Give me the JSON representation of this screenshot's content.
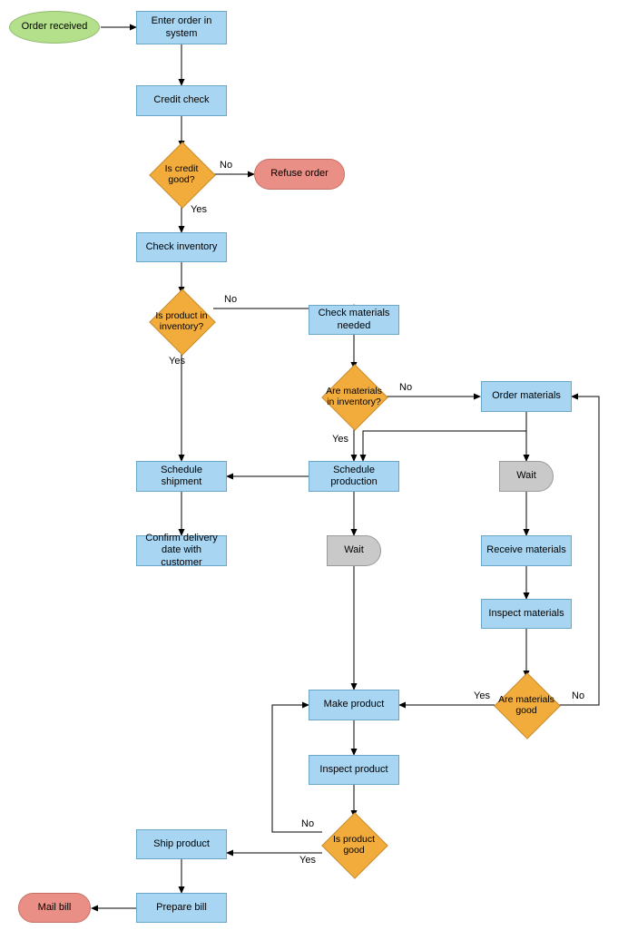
{
  "nodes": {
    "start": {
      "label": "Order received"
    },
    "enter_order": {
      "label": "Enter order in system"
    },
    "credit_check": {
      "label": "Credit check"
    },
    "is_credit_good": {
      "label": "Is credit good?"
    },
    "refuse_order": {
      "label": "Refuse order"
    },
    "check_inventory": {
      "label": "Check inventory"
    },
    "is_in_inventory": {
      "label": "Is product in inventory?"
    },
    "check_materials": {
      "label": "Check materials needed"
    },
    "are_mat_in_inv": {
      "label": "Are materials in inventory?"
    },
    "schedule_ship": {
      "label": "Schedule shipment"
    },
    "order_materials": {
      "label": "Order materials"
    },
    "schedule_prod": {
      "label": "Schedule production"
    },
    "confirm_delivery": {
      "label": "Confirm delivery date with customer"
    },
    "wait1": {
      "label": "Wait"
    },
    "wait2": {
      "label": "Wait"
    },
    "receive_mat": {
      "label": "Receive materials"
    },
    "inspect_mat": {
      "label": "Inspect materials"
    },
    "make_product": {
      "label": "Make product"
    },
    "are_mat_good": {
      "label": "Are materials good"
    },
    "inspect_product": {
      "label": "Inspect product"
    },
    "is_product_good": {
      "label": "Is product good"
    },
    "ship_product": {
      "label": "Ship product"
    },
    "prepare_bill": {
      "label": "Prepare bill"
    },
    "mail_bill": {
      "label": "Mail bill"
    }
  },
  "edge_labels": {
    "credit_no": "No",
    "credit_yes": "Yes",
    "inv_no": "No",
    "inv_yes": "Yes",
    "mat_inv_no": "No",
    "mat_inv_yes": "Yes",
    "mat_good_yes": "Yes",
    "mat_good_no": "No",
    "prod_good_no": "No",
    "prod_good_yes": "Yes"
  },
  "chart_data": {
    "type": "flowchart",
    "nodes": [
      {
        "id": "start",
        "type": "terminator-start",
        "label": "Order received"
      },
      {
        "id": "enter_order",
        "type": "process",
        "label": "Enter order in system"
      },
      {
        "id": "credit_check",
        "type": "process",
        "label": "Credit check"
      },
      {
        "id": "is_credit_good",
        "type": "decision",
        "label": "Is credit good?"
      },
      {
        "id": "refuse_order",
        "type": "terminator-end",
        "label": "Refuse order"
      },
      {
        "id": "check_inventory",
        "type": "process",
        "label": "Check inventory"
      },
      {
        "id": "is_in_inventory",
        "type": "decision",
        "label": "Is product in inventory?"
      },
      {
        "id": "check_materials",
        "type": "process",
        "label": "Check materials needed"
      },
      {
        "id": "are_mat_in_inv",
        "type": "decision",
        "label": "Are materials in inventory?"
      },
      {
        "id": "schedule_ship",
        "type": "process",
        "label": "Schedule shipment"
      },
      {
        "id": "order_materials",
        "type": "process",
        "label": "Order materials"
      },
      {
        "id": "schedule_prod",
        "type": "process",
        "label": "Schedule production"
      },
      {
        "id": "confirm_delivery",
        "type": "process",
        "label": "Confirm delivery date with customer"
      },
      {
        "id": "wait1",
        "type": "delay",
        "label": "Wait"
      },
      {
        "id": "wait2",
        "type": "delay",
        "label": "Wait"
      },
      {
        "id": "receive_mat",
        "type": "process",
        "label": "Receive materials"
      },
      {
        "id": "inspect_mat",
        "type": "process",
        "label": "Inspect materials"
      },
      {
        "id": "make_product",
        "type": "process",
        "label": "Make product"
      },
      {
        "id": "are_mat_good",
        "type": "decision",
        "label": "Are materials good"
      },
      {
        "id": "inspect_product",
        "type": "process",
        "label": "Inspect product"
      },
      {
        "id": "is_product_good",
        "type": "decision",
        "label": "Is product good"
      },
      {
        "id": "ship_product",
        "type": "process",
        "label": "Ship product"
      },
      {
        "id": "prepare_bill",
        "type": "process",
        "label": "Prepare bill"
      },
      {
        "id": "mail_bill",
        "type": "terminator-end",
        "label": "Mail bill"
      }
    ],
    "edges": [
      {
        "from": "start",
        "to": "enter_order"
      },
      {
        "from": "enter_order",
        "to": "credit_check"
      },
      {
        "from": "credit_check",
        "to": "is_credit_good"
      },
      {
        "from": "is_credit_good",
        "to": "refuse_order",
        "label": "No"
      },
      {
        "from": "is_credit_good",
        "to": "check_inventory",
        "label": "Yes"
      },
      {
        "from": "check_inventory",
        "to": "is_in_inventory"
      },
      {
        "from": "is_in_inventory",
        "to": "check_materials",
        "label": "No"
      },
      {
        "from": "is_in_inventory",
        "to": "schedule_ship",
        "label": "Yes"
      },
      {
        "from": "check_materials",
        "to": "are_mat_in_inv"
      },
      {
        "from": "are_mat_in_inv",
        "to": "order_materials",
        "label": "No"
      },
      {
        "from": "are_mat_in_inv",
        "to": "schedule_prod",
        "label": "Yes"
      },
      {
        "from": "order_materials",
        "to": "schedule_prod"
      },
      {
        "from": "order_materials",
        "to": "wait2"
      },
      {
        "from": "schedule_prod",
        "to": "schedule_ship"
      },
      {
        "from": "schedule_ship",
        "to": "confirm_delivery"
      },
      {
        "from": "schedule_prod",
        "to": "wait1"
      },
      {
        "from": "wait1",
        "to": "make_product"
      },
      {
        "from": "wait2",
        "to": "receive_mat"
      },
      {
        "from": "receive_mat",
        "to": "inspect_mat"
      },
      {
        "from": "inspect_mat",
        "to": "are_mat_good"
      },
      {
        "from": "are_mat_good",
        "to": "make_product",
        "label": "Yes"
      },
      {
        "from": "are_mat_good",
        "to": "order_materials",
        "label": "No"
      },
      {
        "from": "make_product",
        "to": "inspect_product"
      },
      {
        "from": "inspect_product",
        "to": "is_product_good"
      },
      {
        "from": "is_product_good",
        "to": "make_product",
        "label": "No"
      },
      {
        "from": "is_product_good",
        "to": "ship_product",
        "label": "Yes"
      },
      {
        "from": "ship_product",
        "to": "prepare_bill"
      },
      {
        "from": "prepare_bill",
        "to": "mail_bill"
      }
    ]
  }
}
